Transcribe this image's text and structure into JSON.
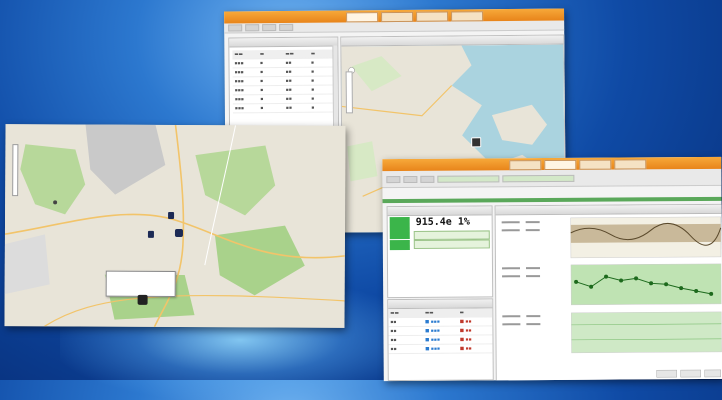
{
  "back_window": {
    "tabs": [
      "",
      "",
      "",
      ""
    ],
    "left_panel_title": "",
    "map_panel_title": ""
  },
  "front_window": {
    "readout": "915.4e 1%",
    "tabs": [
      "",
      "",
      "",
      ""
    ]
  },
  "popup": {
    "line1": "",
    "line2": ""
  },
  "colors": {
    "titlebar": "#e8841a",
    "map_land": "#e8e4d8",
    "map_park": "#a9d28b",
    "map_water": "#aad3df",
    "chart_green": "#2e9a2e",
    "highlight_green": "#3bb54a"
  },
  "icons": [
    "vehicle-marker-icon",
    "map-pin-icon"
  ]
}
